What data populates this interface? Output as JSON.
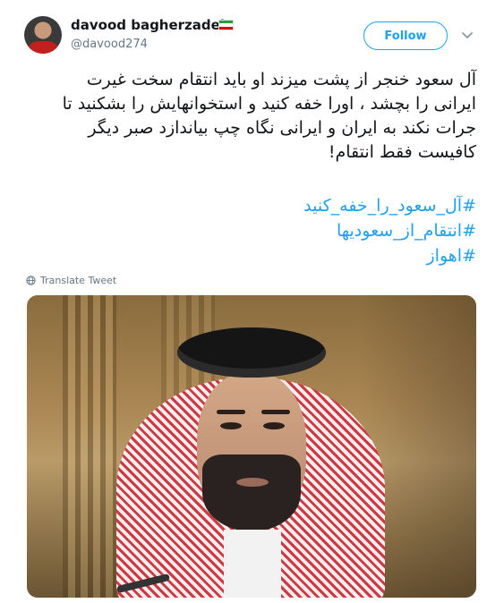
{
  "user": {
    "name": "davood bagherzadeh",
    "handle": "@davood274",
    "flag_colors": [
      "#239f40",
      "#ffffff",
      "#da0000"
    ]
  },
  "actions": {
    "follow_label": "Follow",
    "menu_icon": "chevron-down-icon"
  },
  "tweet": {
    "text": "آل سعود خنجر از پشت میزند او باید انتقام سخت غیرت\nایرانی را بچشد ، اورا خفه کنید و استخوانهایش را بشکنید تا\nجرات نکند به ایران و ایرانی نگاه چپ بیاندازد صبر دیگر\nکافیست فقط انتقام!",
    "hashtags": [
      "#آل_سعود_را_خفه_کنید",
      "#انتقام_از_سعودیها",
      "#اهواز"
    ],
    "translate_label": "Translate Tweet"
  },
  "colors": {
    "accent": "#1da1f2",
    "secondary_text": "#657786",
    "primary_text": "#14171a"
  }
}
